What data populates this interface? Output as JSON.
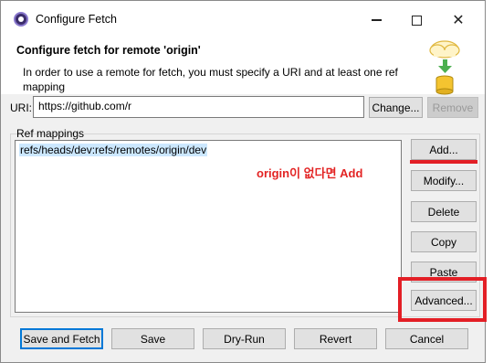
{
  "window": {
    "title": "Configure Fetch"
  },
  "header": {
    "title": "Configure fetch for remote 'origin'",
    "description": "In order to use a remote for fetch, you must specify a URI and at least one ref mapping"
  },
  "uri": {
    "label": "URI:",
    "value": "https://github.com/r",
    "change_label": "Change...",
    "remove_label": "Remove"
  },
  "ref_mappings": {
    "label": "Ref mappings",
    "items": [
      "refs/heads/dev:refs/remotes/origin/dev"
    ],
    "buttons": {
      "add": "Add...",
      "modify": "Modify...",
      "delete": "Delete",
      "copy": "Copy",
      "paste": "Paste",
      "advanced": "Advanced..."
    }
  },
  "annotation": {
    "text": "origin이 없다면 Add",
    "color": "#e32424"
  },
  "footer": {
    "save_fetch": "Save and Fetch",
    "save": "Save",
    "dry_run": "Dry-Run",
    "revert": "Revert",
    "cancel": "Cancel"
  },
  "colors": {
    "accent": "#0078d7",
    "highlight_red": "#e31f26",
    "selection": "#cce8ff"
  },
  "icons": {
    "app": "eclipse-icon",
    "banner": "cloud-database-fetch-icon",
    "minimize": "minimize-icon",
    "maximize": "maximize-icon",
    "close": "close-icon"
  }
}
